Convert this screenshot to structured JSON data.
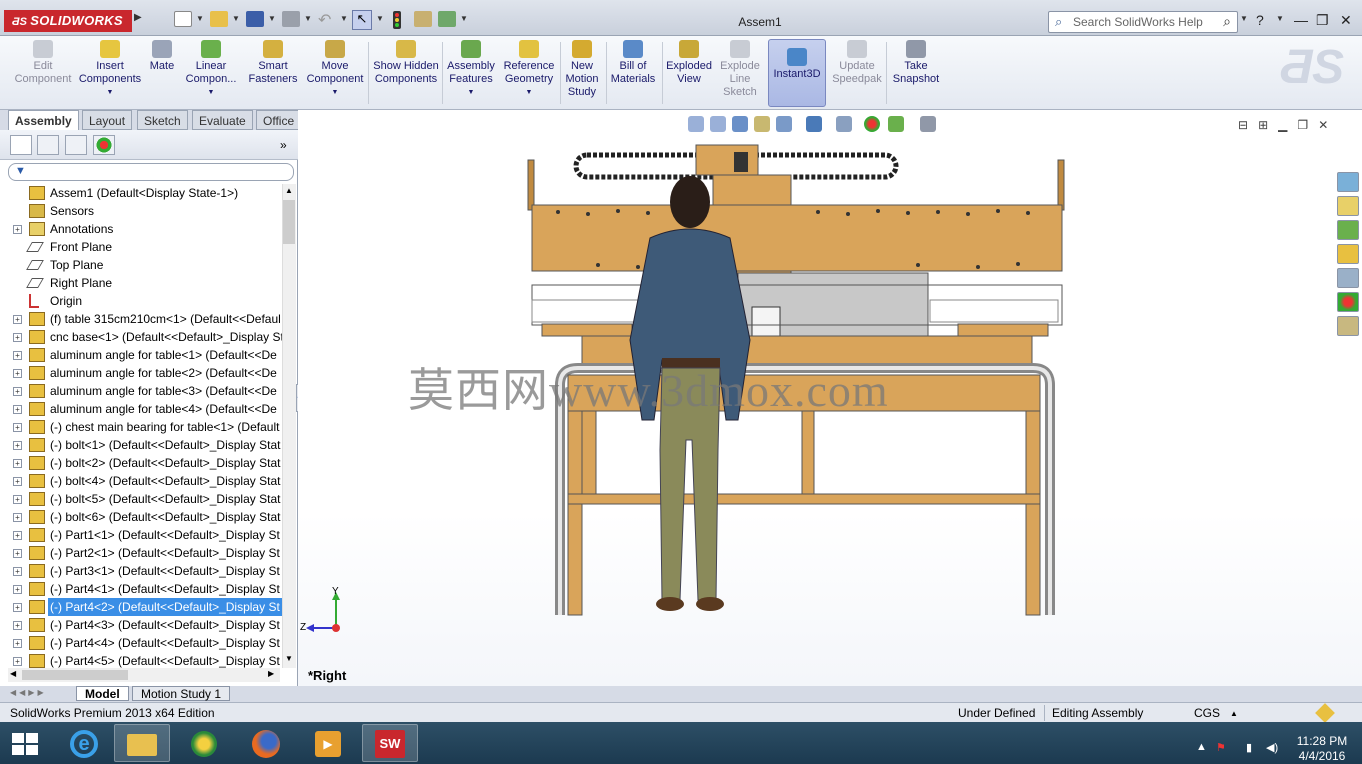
{
  "app": {
    "logo_text": "SOLIDWORKS",
    "window_title": "Assem1",
    "search_placeholder": "Search SolidWorks Help"
  },
  "ribbon": {
    "buttons": [
      {
        "label": "Edit Component",
        "icon": "edit-component-icon",
        "enabled": false
      },
      {
        "label": "Insert Components",
        "icon": "insert-components-icon",
        "enabled": true
      },
      {
        "label": "Mate",
        "icon": "mate-icon",
        "enabled": true
      },
      {
        "label": "Linear Compon...",
        "icon": "linear-pattern-icon",
        "enabled": true
      },
      {
        "label": "Smart Fasteners",
        "icon": "smart-fasteners-icon",
        "enabled": true
      },
      {
        "label": "Move Component",
        "icon": "move-component-icon",
        "enabled": true
      },
      {
        "label": "Show Hidden Components",
        "icon": "show-hidden-icon",
        "enabled": true
      },
      {
        "label": "Assembly Features",
        "icon": "assembly-features-icon",
        "enabled": true
      },
      {
        "label": "Reference Geometry",
        "icon": "reference-geometry-icon",
        "enabled": true
      },
      {
        "label": "New Motion Study",
        "icon": "motion-study-icon",
        "enabled": true
      },
      {
        "label": "Bill of Materials",
        "icon": "bom-icon",
        "enabled": true
      },
      {
        "label": "Exploded View",
        "icon": "exploded-view-icon",
        "enabled": true
      },
      {
        "label": "Explode Line Sketch",
        "icon": "explode-line-icon",
        "enabled": false
      },
      {
        "label": "Instant3D",
        "icon": "instant3d-icon",
        "enabled": true,
        "active": true
      },
      {
        "label": "Update Speedpak",
        "icon": "speedpak-icon",
        "enabled": false
      },
      {
        "label": "Take Snapshot",
        "icon": "snapshot-icon",
        "enabled": true
      }
    ]
  },
  "command_tabs": [
    "Assembly",
    "Layout",
    "Sketch",
    "Evaluate",
    "Office Products"
  ],
  "tree": {
    "items": [
      {
        "label": "Assem1  (Default<Display State-1>)",
        "icon": "assembly-icon",
        "expander": ""
      },
      {
        "label": "Sensors",
        "icon": "sensors-icon",
        "expander": ""
      },
      {
        "label": "Annotations",
        "icon": "annotations-icon",
        "expander": "+"
      },
      {
        "label": "Front Plane",
        "icon": "plane-icon",
        "expander": ""
      },
      {
        "label": "Top Plane",
        "icon": "plane-icon",
        "expander": ""
      },
      {
        "label": "Right Plane",
        "icon": "plane-icon",
        "expander": ""
      },
      {
        "label": "Origin",
        "icon": "origin-icon",
        "expander": ""
      },
      {
        "label": "(f) table 315cm210cm<1> (Default<<Defaul",
        "icon": "part-icon",
        "expander": "+"
      },
      {
        "label": "cnc base<1> (Default<<Default>_Display St",
        "icon": "part-icon",
        "expander": "+"
      },
      {
        "label": "aluminum angle for table<1> (Default<<De",
        "icon": "part-icon",
        "expander": "+"
      },
      {
        "label": "aluminum angle for table<2> (Default<<De",
        "icon": "part-icon",
        "expander": "+"
      },
      {
        "label": "aluminum angle for table<3> (Default<<De",
        "icon": "part-icon",
        "expander": "+"
      },
      {
        "label": "aluminum angle for table<4> (Default<<De",
        "icon": "part-icon",
        "expander": "+"
      },
      {
        "label": "(-) chest main bearing for table<1> (Default",
        "icon": "part-icon",
        "expander": "+"
      },
      {
        "label": "(-) bolt<1> (Default<<Default>_Display Stat",
        "icon": "part-icon",
        "expander": "+"
      },
      {
        "label": "(-) bolt<2> (Default<<Default>_Display Stat",
        "icon": "part-icon",
        "expander": "+"
      },
      {
        "label": "(-) bolt<4> (Default<<Default>_Display Stat",
        "icon": "part-icon",
        "expander": "+"
      },
      {
        "label": "(-) bolt<5> (Default<<Default>_Display Stat",
        "icon": "part-icon",
        "expander": "+"
      },
      {
        "label": "(-) bolt<6> (Default<<Default>_Display Stat",
        "icon": "part-icon",
        "expander": "+"
      },
      {
        "label": "(-) Part1<1> (Default<<Default>_Display St",
        "icon": "part-icon",
        "expander": "+"
      },
      {
        "label": "(-) Part2<1> (Default<<Default>_Display St",
        "icon": "part-icon",
        "expander": "+"
      },
      {
        "label": "(-) Part3<1> (Default<<Default>_Display St",
        "icon": "part-icon",
        "expander": "+"
      },
      {
        "label": "(-) Part4<1> (Default<<Default>_Display St",
        "icon": "part-icon",
        "expander": "+"
      },
      {
        "label": "(-) Part4<2> (Default<<Default>_Display St",
        "icon": "part-icon",
        "expander": "+",
        "selected": true
      },
      {
        "label": "(-) Part4<3> (Default<<Default>_Display St",
        "icon": "part-icon",
        "expander": "+"
      },
      {
        "label": "(-) Part4<4> (Default<<Default>_Display St",
        "icon": "part-icon",
        "expander": "+"
      },
      {
        "label": "(-) Part4<5> (Default<<Default>_Display St",
        "icon": "part-icon",
        "expander": "+"
      }
    ]
  },
  "viewport": {
    "view_name": "*Right",
    "watermark": "莫西网www.3dmox.com",
    "triad": {
      "y_label": "Y",
      "z_label": "Z"
    }
  },
  "bottom_tabs": [
    "Model",
    "Motion Study 1"
  ],
  "status": {
    "edition": "SolidWorks Premium 2013 x64 Edition",
    "definition": "Under Defined",
    "mode": "Editing Assembly",
    "units": "CGS"
  },
  "taskbar": {
    "time": "11:28 PM",
    "date": "4/4/2016"
  },
  "colors": {
    "wood": "#d9a45a",
    "accent_red": "#c9272d",
    "selection": "#3a8ee6"
  }
}
